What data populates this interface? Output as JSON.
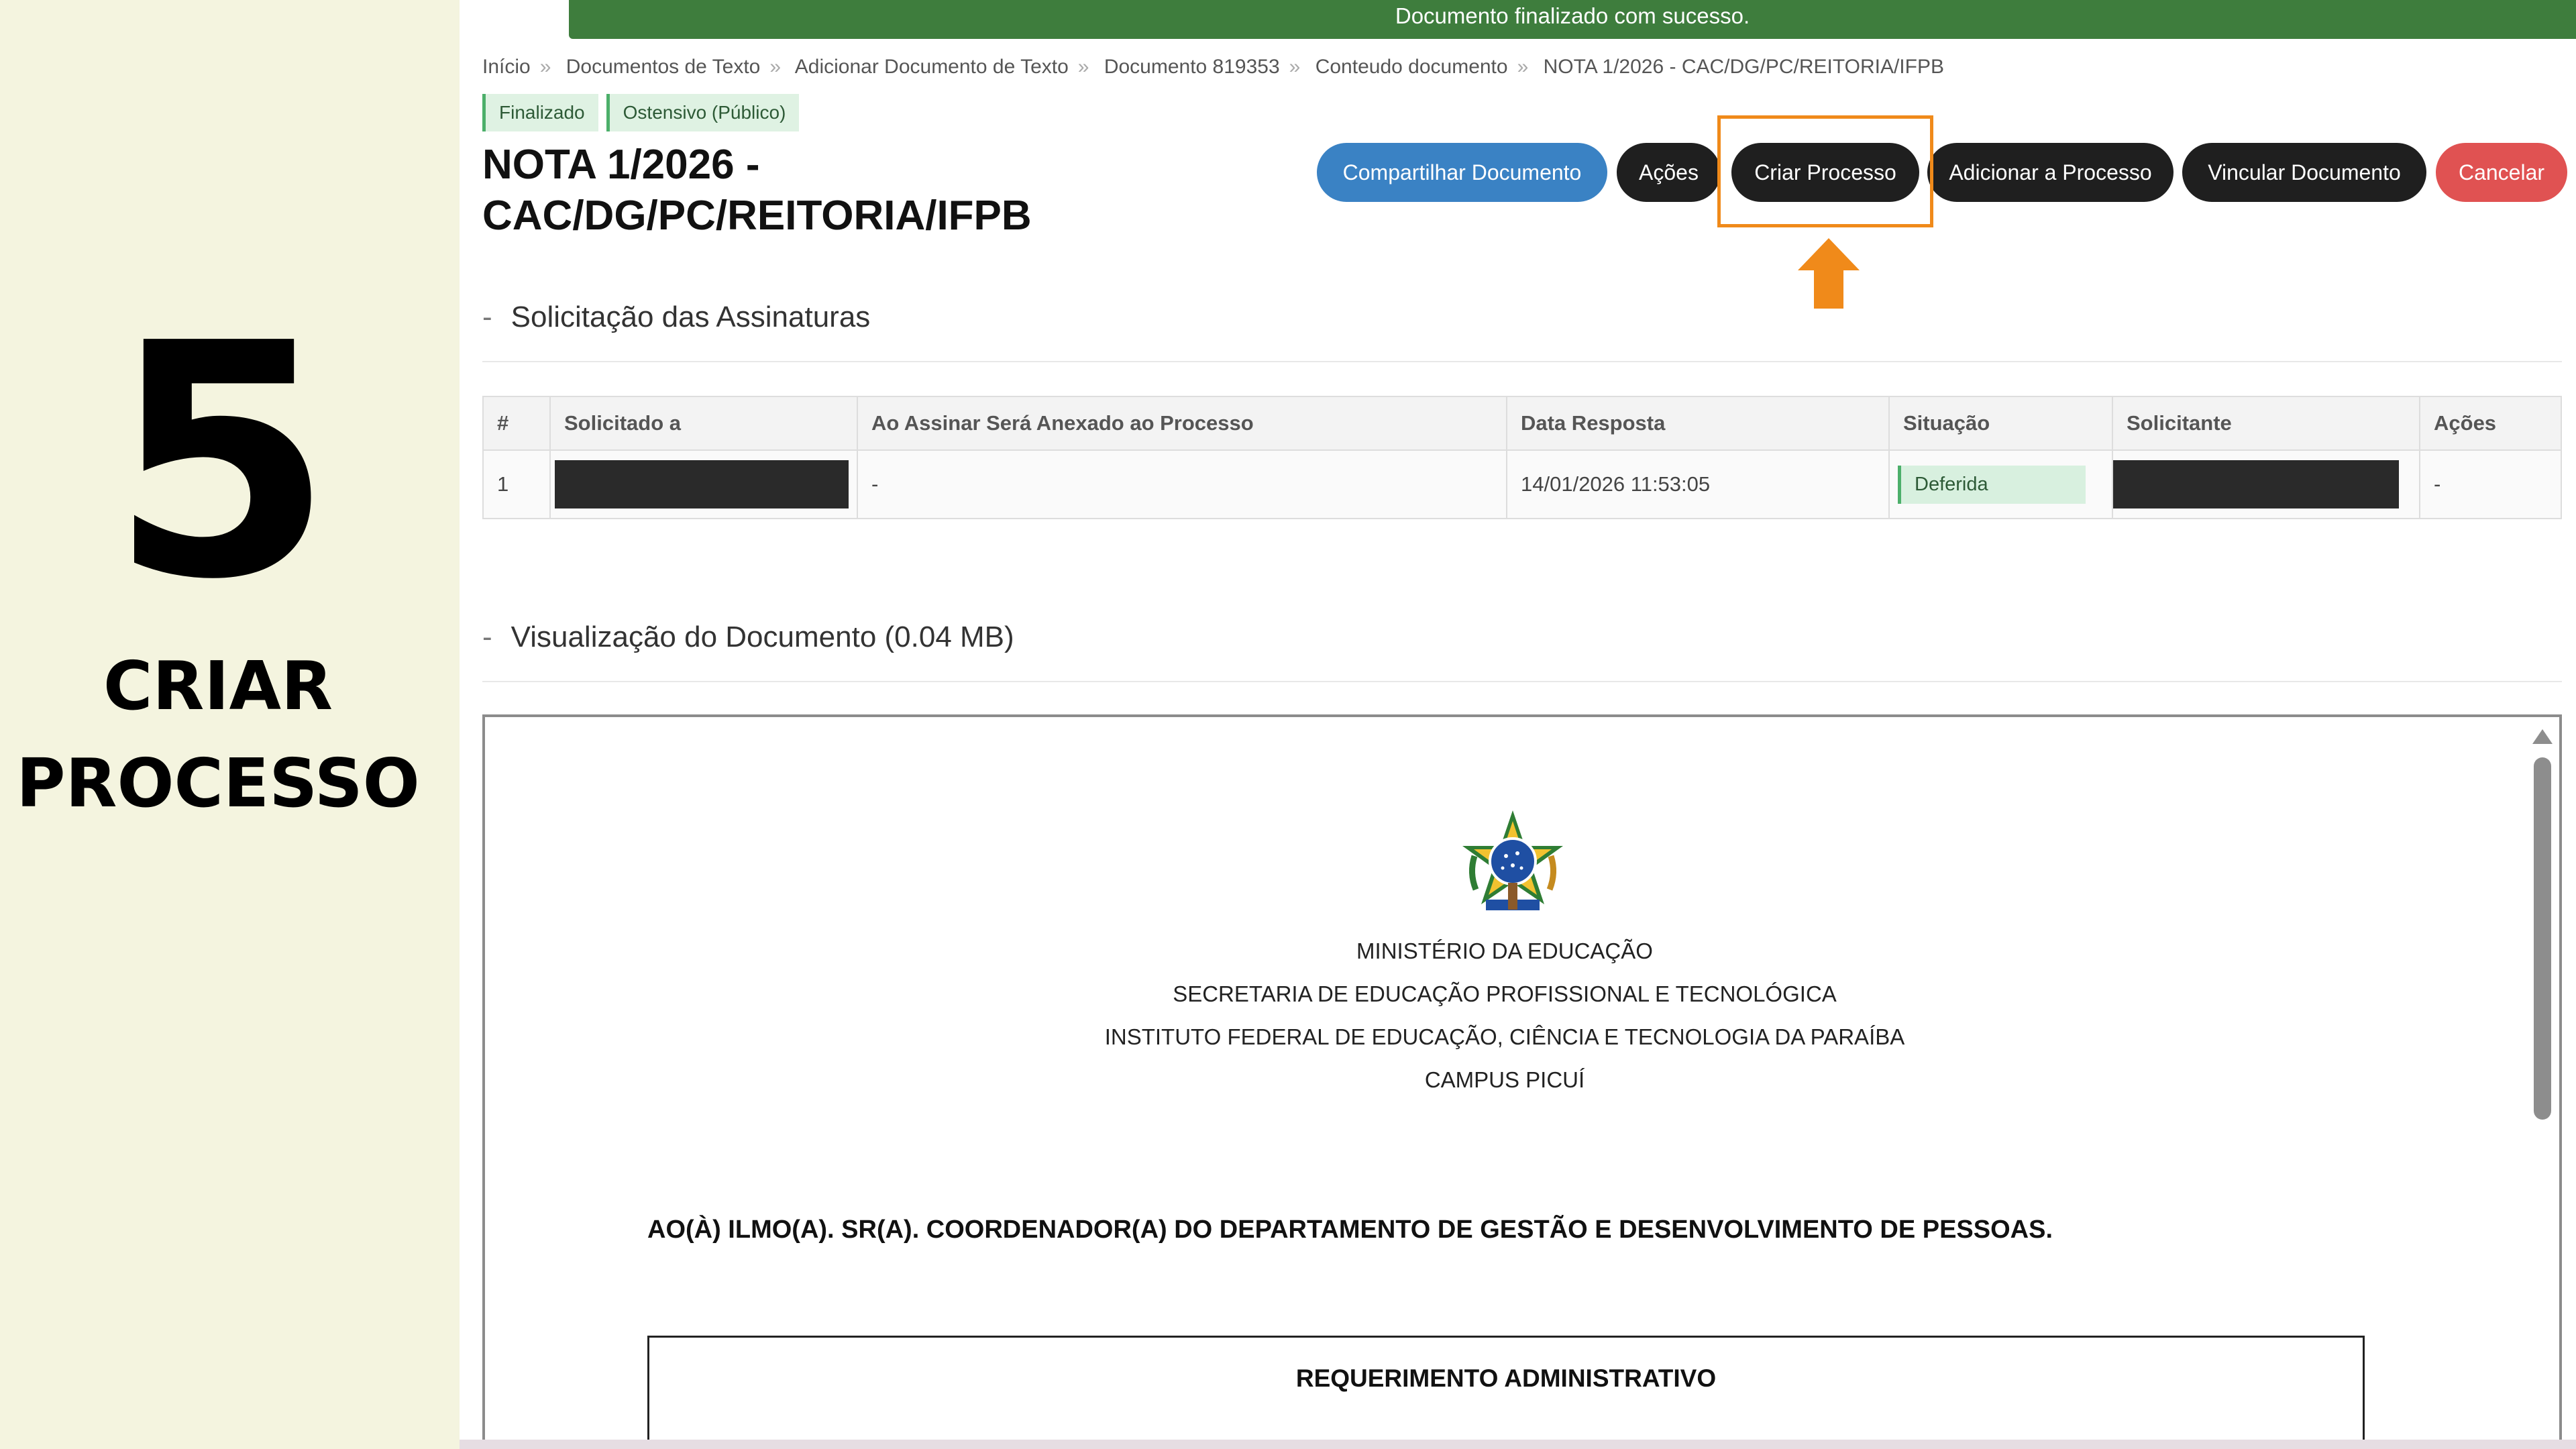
{
  "tutorial": {
    "step_number": "5",
    "step_title_line1": "CRIAR",
    "step_title_line2": "PROCESSO"
  },
  "toast": {
    "message": "Documento finalizado com sucesso."
  },
  "breadcrumb": [
    "Início",
    "Documentos de Texto",
    "Adicionar Documento de Texto",
    "Documento 819353",
    "Conteudo documento",
    "NOTA 1/2026 - CAC/DG/PC/REITORIA/IFPB"
  ],
  "badges": {
    "status": "Finalizado",
    "access": "Ostensivo (Público)"
  },
  "document": {
    "title_line1": "NOTA 1/2026 -",
    "title_line2": "CAC/DG/PC/REITORIA/IFPB"
  },
  "actions": {
    "share": "Compartilhar Documento",
    "acoes": "Ações",
    "criar_processo": "Criar Processo",
    "adicionar_processo": "Adicionar a Processo",
    "vincular": "Vincular Documento",
    "cancelar": "Cancelar"
  },
  "signatures": {
    "section_title": "Solicitação das Assinaturas",
    "columns": [
      "#",
      "Solicitado a",
      "Ao Assinar Será Anexado ao Processo",
      "Data Resposta",
      "Situação",
      "Solicitante",
      "Ações"
    ],
    "rows": [
      {
        "num": "1",
        "anexado": "-",
        "data_resposta": "14/01/2026 11:53:05",
        "situacao": "Deferida",
        "acoes": "-"
      }
    ]
  },
  "preview": {
    "section_title": "Visualização do Documento (0.04 MB)",
    "org_lines": [
      "MINISTÉRIO DA EDUCAÇÃO",
      "SECRETARIA DE EDUCAÇÃO PROFISSIONAL E TECNOLÓGICA",
      "INSTITUTO FEDERAL DE EDUCAÇÃO, CIÊNCIA E TECNOLOGIA DA PARAÍBA",
      "CAMPUS PICUÍ"
    ],
    "addressee": "AO(À) ILMO(A). SR(A). COORDENADOR(A) DO DEPARTAMENTO DE GESTÃO E DESENVOLVIMENTO DE PESSOAS.",
    "request_title": "REQUERIMENTO ADMINISTRATIVO"
  },
  "colors": {
    "toast": "#3e7d3d",
    "primary": "#3a82c4",
    "dark": "#1f1f1f",
    "danger": "#e05252",
    "highlight": "#f08a1a",
    "left_panel": "#f4f4df"
  },
  "icons": {
    "pointer": "arrow-up-icon",
    "emblem": "brasao-republica-icon"
  }
}
